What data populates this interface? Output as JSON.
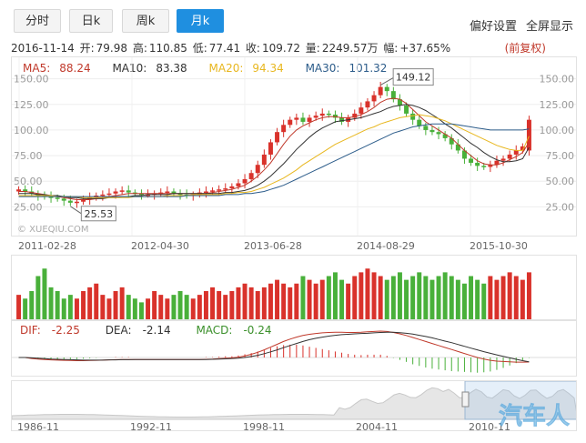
{
  "tabs": [
    {
      "label": "分时",
      "active": false
    },
    {
      "label": "日k",
      "active": false
    },
    {
      "label": "周k",
      "active": false
    },
    {
      "label": "月k",
      "active": true
    }
  ],
  "links": {
    "prefs": "偏好设置",
    "fullscreen": "全屏显示"
  },
  "info": {
    "date": "2016-11-14",
    "open_label": "开:",
    "open": "79.98",
    "high_label": "高:",
    "high": "110.85",
    "low_label": "低:",
    "low": "77.41",
    "close_label": "收:",
    "close": "109.72",
    "vol_label": "量:",
    "vol": "2249.57万",
    "chg_label": "幅:",
    "chg": "+37.65%",
    "adjust": "(前复权)"
  },
  "ma": [
    {
      "label": "MA5:",
      "value": "88.24",
      "color": "#c0392b"
    },
    {
      "label": "MA10:",
      "value": "83.38",
      "color": "#333333"
    },
    {
      "label": "MA20:",
      "value": "94.34",
      "color": "#e8b71f"
    },
    {
      "label": "MA30:",
      "value": "101.32",
      "color": "#2c5c8a"
    }
  ],
  "macd": [
    {
      "label": "DIF:",
      "value": "-2.25",
      "color": "#c0392b"
    },
    {
      "label": "DEA:",
      "value": "-2.14",
      "color": "#333333"
    },
    {
      "label": "MACD:",
      "value": "-0.24",
      "color": "#3a8f2a"
    }
  ],
  "watermark": "XUEQIU.COM",
  "logo_text": "汽车人",
  "colors": {
    "up": "#d9322b",
    "down": "#49b03a",
    "accent": "#1f8fe0"
  },
  "chart_data": {
    "type": "candlestick",
    "x_ticks": [
      "2011-02-28",
      "2012-04-30",
      "2013-06-28",
      "2014-08-29",
      "2015-10-30"
    ],
    "y_ticks": [
      "150.00",
      "125.00",
      "100.00",
      "75.00",
      "50.00",
      "25.00"
    ],
    "ylim": [
      20,
      155
    ],
    "max_label": "149.12",
    "min_label": "25.53",
    "close": [
      42,
      40,
      38,
      36,
      35,
      34,
      33,
      31,
      29,
      30,
      32,
      34,
      36,
      37,
      38,
      40,
      41,
      39,
      38,
      37,
      37,
      38,
      39,
      40,
      38,
      37,
      36,
      37,
      39,
      40,
      41,
      42,
      43,
      45,
      48,
      52,
      58,
      66,
      76,
      88,
      98,
      105,
      110,
      112,
      108,
      112,
      114,
      116,
      115,
      112,
      108,
      112,
      116,
      122,
      128,
      134,
      142,
      138,
      130,
      124,
      116,
      110,
      104,
      100,
      98,
      96,
      92,
      86,
      80,
      72,
      68,
      65,
      64,
      66,
      70,
      72,
      76,
      80,
      84,
      110
    ],
    "open": [
      40,
      42,
      40,
      38,
      36,
      35,
      34,
      33,
      31,
      29,
      30,
      32,
      34,
      36,
      37,
      38,
      40,
      41,
      39,
      38,
      37,
      37,
      38,
      39,
      40,
      38,
      37,
      36,
      37,
      39,
      40,
      41,
      42,
      43,
      45,
      48,
      52,
      58,
      66,
      76,
      88,
      98,
      105,
      110,
      112,
      108,
      112,
      114,
      116,
      115,
      112,
      108,
      112,
      116,
      122,
      128,
      134,
      142,
      138,
      130,
      124,
      116,
      110,
      104,
      100,
      98,
      96,
      92,
      86,
      80,
      72,
      68,
      65,
      64,
      66,
      70,
      72,
      76,
      80,
      80
    ],
    "ma_series": {
      "MA5": [
        40,
        40,
        39,
        38,
        37,
        36,
        35,
        34,
        33,
        32,
        32,
        32,
        33,
        34,
        35,
        36,
        37,
        38,
        38,
        38,
        38,
        38,
        38,
        38,
        38,
        38,
        38,
        38,
        38,
        38,
        39,
        40,
        41,
        42,
        44,
        46,
        50,
        55,
        61,
        68,
        77,
        86,
        94,
        100,
        104,
        107,
        110,
        112,
        113,
        113,
        112,
        112,
        113,
        115,
        118,
        122,
        127,
        130,
        131,
        130,
        126,
        120,
        114,
        108,
        104,
        100,
        96,
        92,
        86,
        80,
        75,
        70,
        67,
        66,
        66,
        68,
        71,
        74,
        78,
        88
      ],
      "MA10": [
        38,
        38,
        38,
        37,
        37,
        36,
        36,
        35,
        34,
        34,
        33,
        33,
        33,
        33,
        34,
        34,
        35,
        35,
        36,
        36,
        37,
        37,
        37,
        37,
        38,
        38,
        38,
        38,
        38,
        38,
        38,
        38,
        39,
        39,
        40,
        41,
        43,
        46,
        50,
        55,
        61,
        67,
        74,
        81,
        87,
        93,
        98,
        102,
        105,
        108,
        109,
        110,
        111,
        112,
        114,
        116,
        118,
        121,
        123,
        124,
        125,
        124,
        122,
        119,
        115,
        111,
        106,
        102,
        97,
        92,
        87,
        83,
        78,
        74,
        71,
        69,
        69,
        70,
        72,
        83
      ],
      "MA20": [
        36,
        36,
        36,
        36,
        36,
        36,
        35,
        35,
        35,
        35,
        34,
        34,
        34,
        34,
        34,
        34,
        34,
        34,
        35,
        35,
        35,
        35,
        35,
        36,
        36,
        36,
        36,
        37,
        37,
        37,
        37,
        37,
        38,
        38,
        39,
        39,
        40,
        42,
        44,
        47,
        50,
        53,
        57,
        61,
        66,
        70,
        74,
        78,
        82,
        86,
        89,
        92,
        95,
        98,
        101,
        103,
        106,
        108,
        110,
        112,
        113,
        114,
        115,
        114,
        113,
        111,
        109,
        106,
        103,
        100,
        97,
        94,
        91,
        88,
        85,
        83,
        81,
        80,
        80,
        94
      ],
      "MA30": [
        35,
        35,
        35,
        35,
        35,
        35,
        35,
        35,
        35,
        35,
        35,
        35,
        35,
        35,
        35,
        35,
        35,
        35,
        35,
        35,
        35,
        35,
        35,
        35,
        35,
        35,
        36,
        36,
        36,
        36,
        36,
        36,
        37,
        37,
        37,
        38,
        38,
        39,
        40,
        42,
        44,
        46,
        49,
        52,
        55,
        58,
        61,
        64,
        67,
        70,
        73,
        76,
        79,
        82,
        85,
        88,
        91,
        94,
        97,
        99,
        101,
        103,
        104,
        105,
        106,
        106,
        106,
        106,
        105,
        104,
        103,
        102,
        101,
        100,
        100,
        100,
        100,
        100,
        100,
        101
      ]
    },
    "volume": [
      35,
      30,
      40,
      60,
      70,
      45,
      40,
      30,
      35,
      30,
      40,
      45,
      50,
      35,
      30,
      40,
      45,
      35,
      30,
      25,
      30,
      40,
      35,
      30,
      35,
      40,
      35,
      30,
      35,
      40,
      45,
      40,
      35,
      40,
      45,
      50,
      45,
      40,
      45,
      50,
      55,
      50,
      45,
      50,
      60,
      55,
      50,
      55,
      60,
      65,
      55,
      50,
      60,
      65,
      70,
      65,
      60,
      55,
      60,
      65,
      55,
      60,
      65,
      60,
      55,
      60,
      65,
      60,
      55,
      50,
      60,
      55,
      50,
      60,
      55,
      60,
      65,
      60,
      55,
      65
    ],
    "dif": [
      0,
      0,
      -0.5,
      -0.8,
      -1,
      -1.2,
      -1.3,
      -1.4,
      -1.5,
      -1.6,
      -1.6,
      -1.5,
      -1.4,
      -1.3,
      -1.2,
      -1.1,
      -1,
      -1,
      -1,
      -1,
      -1,
      -1,
      -1,
      -1,
      -1,
      -1,
      -1,
      -1,
      -1,
      -0.9,
      -0.8,
      -0.6,
      -0.4,
      -0.2,
      0.2,
      0.8,
      1.6,
      2.6,
      3.8,
      5.2,
      6.6,
      8,
      9.2,
      10.2,
      11,
      11.6,
      12,
      12.3,
      12.5,
      12.6,
      12.6,
      12.5,
      12.5,
      12.6,
      12.8,
      13,
      13.2,
      13,
      12.5,
      11.8,
      11,
      10,
      9,
      8,
      7,
      6,
      5,
      4,
      3,
      2,
      1,
      0,
      -0.8,
      -1.4,
      -1.8,
      -2,
      -2.2,
      -2.3,
      -2.3,
      -2.25
    ],
    "dea": [
      0,
      0,
      -0.2,
      -0.4,
      -0.6,
      -0.8,
      -0.9,
      -1,
      -1.1,
      -1.2,
      -1.3,
      -1.3,
      -1.3,
      -1.3,
      -1.2,
      -1.2,
      -1.1,
      -1.1,
      -1,
      -1,
      -1,
      -1,
      -1,
      -1,
      -1,
      -1,
      -1,
      -1,
      -1,
      -1,
      -0.9,
      -0.8,
      -0.7,
      -0.5,
      -0.3,
      0,
      0.5,
      1.1,
      1.9,
      2.8,
      3.8,
      4.9,
      6,
      7,
      8,
      8.9,
      9.6,
      10.2,
      10.7,
      11.1,
      11.4,
      11.6,
      11.8,
      12,
      12.1,
      12.3,
      12.5,
      12.6,
      12.6,
      12.4,
      12.1,
      11.7,
      11.1,
      10.5,
      9.8,
      9,
      8.2,
      7.4,
      6.5,
      5.6,
      4.7,
      3.8,
      2.9,
      2.1,
      1.3,
      0.6,
      -0.2,
      -0.9,
      -1.6,
      -2.14
    ]
  }
}
